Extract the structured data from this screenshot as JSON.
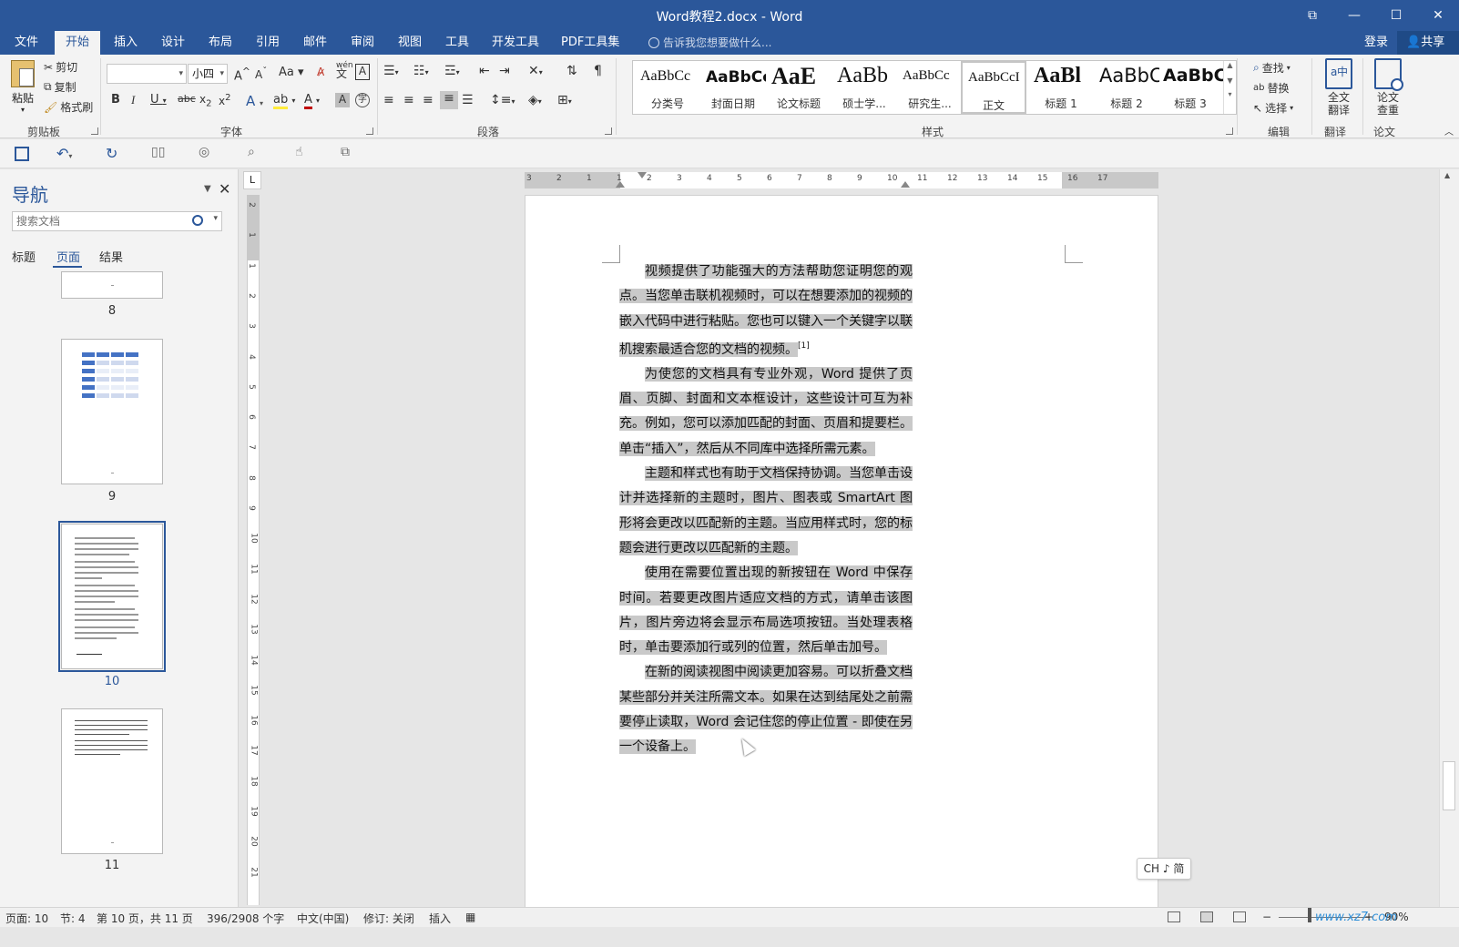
{
  "window": {
    "title": "Word教程2.docx - Word",
    "controls": [
      "⧉",
      "—",
      "☐",
      "✕"
    ]
  },
  "ribbon_tabs": [
    "文件",
    "开始",
    "插入",
    "设计",
    "布局",
    "引用",
    "邮件",
    "审阅",
    "视图",
    "工具",
    "开发工具",
    "PDF工具集"
  ],
  "active_tab": "开始",
  "tell_me": "告诉我您想要做什么...",
  "account": {
    "login": "登录",
    "share": "共享"
  },
  "clipboard": {
    "paste": "粘贴",
    "cut": "剪切",
    "copy": "复制",
    "format_painter": "格式刷",
    "label": "剪贴板"
  },
  "font": {
    "name": "",
    "size": "小四",
    "label": "字体",
    "case_btn": "Aa",
    "wen": "wén"
  },
  "paragraph": {
    "label": "段落"
  },
  "styles": {
    "label": "样式",
    "items": [
      {
        "sample": "AaBbCc",
        "name": "分类号"
      },
      {
        "sample": "AaBbCc",
        "name": "封面日期"
      },
      {
        "sample": "AaE",
        "name": "论文标题"
      },
      {
        "sample": "AaBb",
        "name": "硕士学..."
      },
      {
        "sample": "AaBbCc",
        "name": "研究生..."
      },
      {
        "sample": "AaBbCcI",
        "name": "正文"
      },
      {
        "sample": "AaBl",
        "name": "标题 1"
      },
      {
        "sample": "AaBbC",
        "name": "标题 2"
      },
      {
        "sample": "AaBbC",
        "name": "标题 3"
      }
    ],
    "selected": "正文"
  },
  "editing": {
    "find": "查找",
    "replace": "替换",
    "select": "选择",
    "label": "编辑"
  },
  "translate": {
    "button": "全文翻译",
    "label": "翻译"
  },
  "paper": {
    "button": "论文查重",
    "label": "论文"
  },
  "navigation": {
    "title": "导航",
    "search_placeholder": "搜索文档",
    "tabs": [
      "标题",
      "页面",
      "结果"
    ],
    "active_tab": "页面",
    "pages": [
      "8",
      "9",
      "10",
      "11"
    ],
    "selected_page": "10"
  },
  "document": {
    "paragraphs": [
      "视频提供了功能强大的方法帮助您证明您的观点。当您单击联机视频时，可以在想要添加的视频的嵌入代码中进行粘贴。您也可以键入一个关键字以联机搜索最适合您的文档的视频。",
      "为使您的文档具有专业外观，Word 提供了页眉、页脚、封面和文本框设计，这些设计可互为补充。例如，您可以添加匹配的封面、页眉和提要栏。单击“插入”，然后从不同库中选择所需元素。",
      "主题和样式也有助于文档保持协调。当您单击设计并选择新的主题时，图片、图表或 SmartArt 图形将会更改以匹配新的主题。当应用样式时，您的标题会进行更改以匹配新的主题。",
      "使用在需要位置出现的新按钮在 Word 中保存时间。若要更改图片适应文档的方式，请单击该图片，图片旁边将会显示布局选项按钮。当处理表格时，单击要添加行或列的位置，然后单击加号。",
      "在新的阅读视图中阅读更加容易。可以折叠文档某些部分并关注所需文本。如果在达到结尾处之前需要停止读取，Word 会记住您的停止位置 - 即使在另一个设备上。"
    ],
    "footnote_ref": "[1]"
  },
  "ruler": {
    "h_ticks": [
      "3",
      "2",
      "1",
      "1",
      "2",
      "3",
      "4",
      "5",
      "6",
      "7",
      "8",
      "9",
      "10",
      "11",
      "12",
      "13",
      "14",
      "15",
      "16",
      "17"
    ],
    "v_ticks": [
      "2",
      "1",
      "1",
      "2",
      "3",
      "4",
      "5",
      "6",
      "7",
      "8",
      "9",
      "10",
      "11",
      "12",
      "13",
      "14",
      "15",
      "16",
      "17",
      "18",
      "19",
      "20",
      "21"
    ],
    "corner": "L"
  },
  "ime": "CH ♪ 简",
  "status": {
    "page": "页面: 10",
    "section": "节: 4",
    "page_of": "第 10 页，共 11 页",
    "words": "396/2908 个字",
    "lang": "中文(中国)",
    "track": "修订: 关闭",
    "insert": "插入",
    "zoom": "90%",
    "watermark": "www.xz7.com"
  }
}
